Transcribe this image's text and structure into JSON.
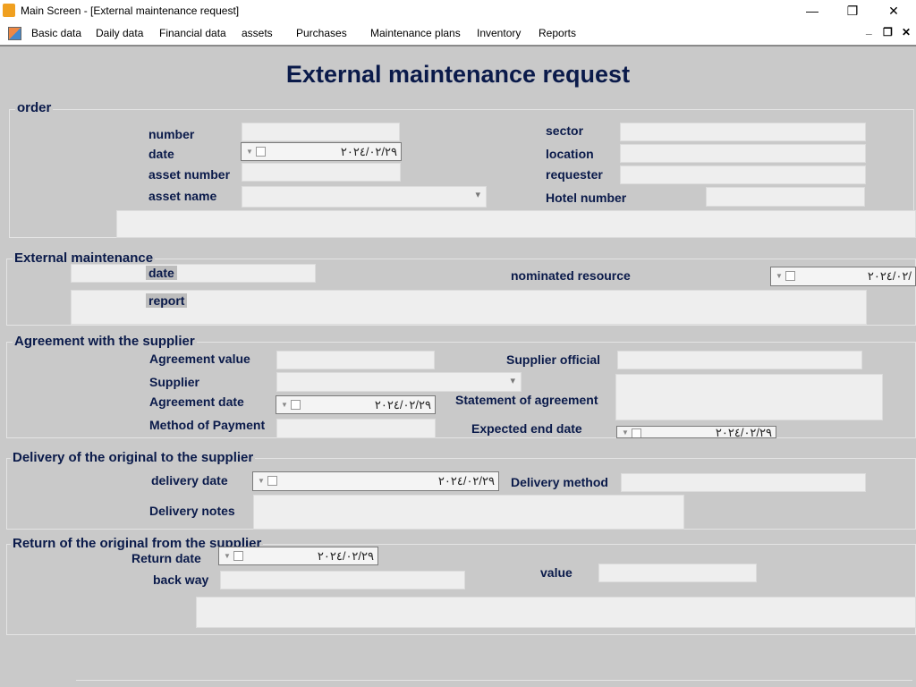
{
  "window": {
    "title": "Main Screen - [External maintenance request]",
    "minimize": "—",
    "maximize": "❐",
    "close": "✕"
  },
  "menu": {
    "items": [
      "Basic data",
      "Daily data",
      "Financial data",
      "assets",
      "Purchases",
      "Maintenance plans",
      "Inventory",
      "Reports"
    ],
    "mdi_minimize": "_",
    "mdi_restore": "❐",
    "mdi_close": "✕"
  },
  "form": {
    "heading": "External maintenance request",
    "order": {
      "title": "order",
      "labels": {
        "number": "number",
        "date": "date",
        "asset_number": "asset number",
        "asset_name": "asset name",
        "sector": "sector",
        "location": "location",
        "requester": "requester",
        "hotel_number": "Hotel number"
      },
      "date_value": "٢٠٢٤/٠٢/٢٩"
    },
    "external": {
      "title": "External maintenance",
      "labels": {
        "date": "date",
        "report": "report",
        "nominated_resource": "nominated resource"
      },
      "resource_date_value": "٢٠٢٤/٠٢/"
    },
    "agreement": {
      "title": "Agreement with the supplier",
      "labels": {
        "agreement_value": "Agreement value",
        "supplier": "Supplier",
        "agreement_date": "Agreement date",
        "method_of_payment": "Method of Payment",
        "supplier_official": "Supplier official",
        "statement_of_agreement": "Statement of agreement",
        "expected_end_date": "Expected end date"
      },
      "agreement_date_value": "٢٠٢٤/٠٢/٢٩",
      "expected_end_value": "٢٠٢٤/٠٢/٢٩"
    },
    "delivery": {
      "title": "Delivery of the original to the supplier",
      "labels": {
        "delivery_date": "delivery date",
        "delivery_method": "Delivery method",
        "delivery_notes": "Delivery notes"
      },
      "delivery_date_value": "٢٠٢٤/٠٢/٢٩"
    },
    "return": {
      "title": "Return of the original from the supplier",
      "labels": {
        "return_date": "Return date",
        "back_way": "back way",
        "value": "value"
      },
      "return_date_value": "٢٠٢٤/٠٢/٢٩"
    }
  },
  "colors": {
    "form_bg": "#c9c9c9",
    "label": "#0a1a4a",
    "field": "#eeeeee"
  },
  "icons": {
    "app": "app-icon",
    "mdi": "mdi-window-icon",
    "dropdown": "chevron-down-icon",
    "checkbox": "checkbox-icon"
  }
}
